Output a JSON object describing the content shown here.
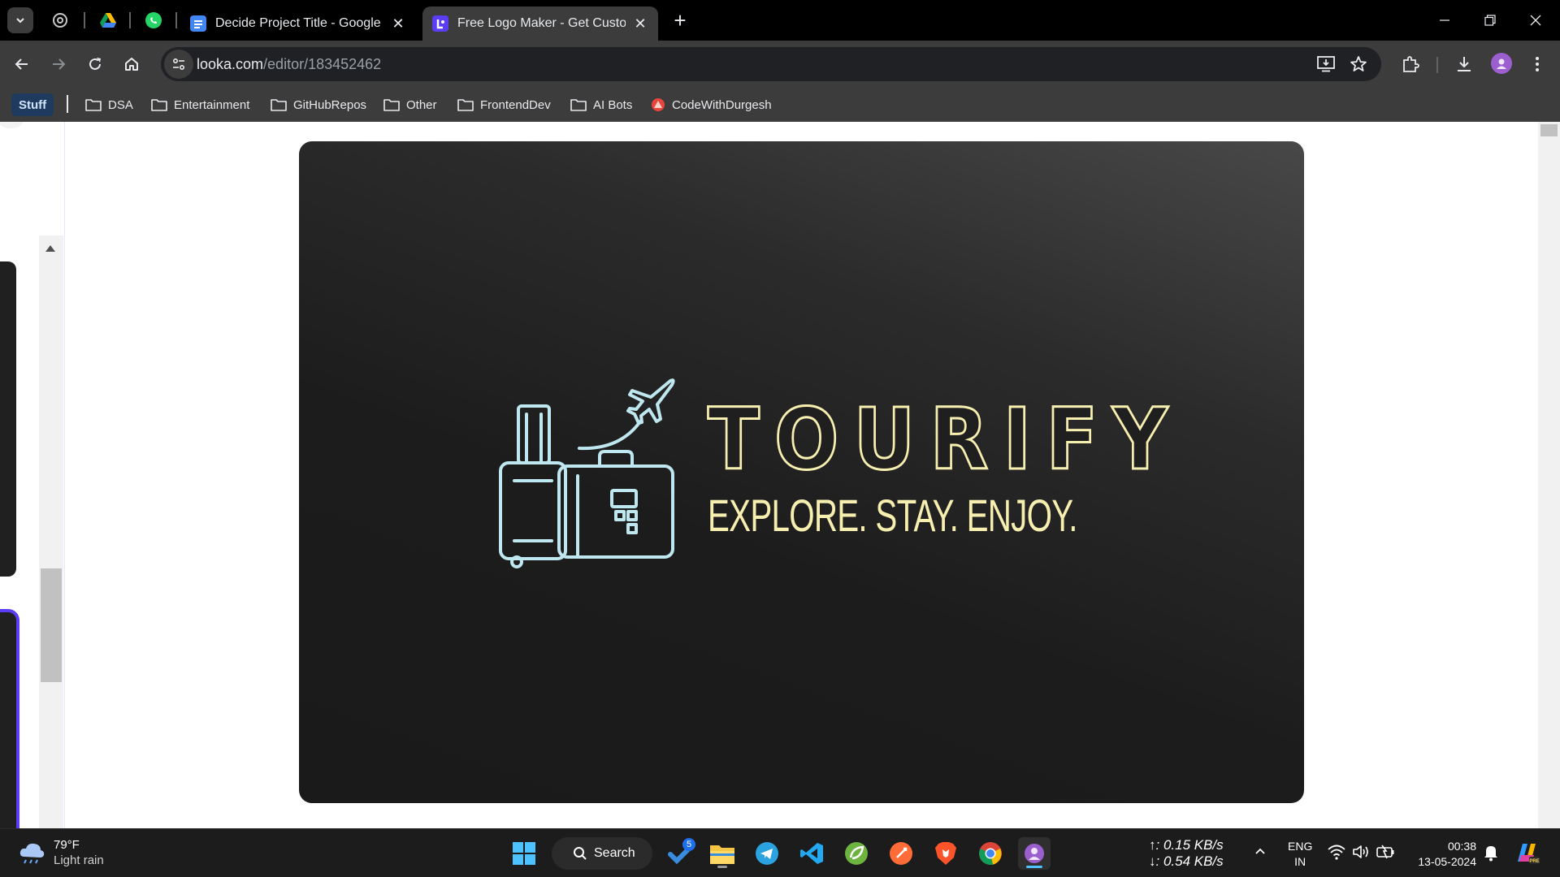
{
  "browser": {
    "tabs": [
      {
        "title": "Decide Project Title - Google Docs",
        "favicon": "google-docs-icon",
        "active": false
      },
      {
        "title": "Free Logo Maker - Get Custom Logo Designs",
        "favicon": "looka-icon",
        "active": true
      }
    ],
    "pinned_tabs": [
      "chatgpt-icon",
      "google-drive-icon",
      "whatsapp-icon"
    ],
    "url": {
      "domain": "looka.com",
      "path": "/editor/183452462"
    },
    "bookmarks": [
      {
        "label": "Stuff",
        "type": "app"
      },
      {
        "label": "DSA",
        "type": "folder"
      },
      {
        "label": "Entertainment",
        "type": "folder"
      },
      {
        "label": "GitHubRepos",
        "type": "folder"
      },
      {
        "label": "Other",
        "type": "folder"
      },
      {
        "label": "FrontendDev",
        "type": "folder"
      },
      {
        "label": "AI Bots",
        "type": "folder"
      },
      {
        "label": "CodeWithDurgesh",
        "type": "site"
      }
    ]
  },
  "logo": {
    "name": "TOURIFY",
    "tagline": "EXPLORE. STAY. ENJOY.",
    "name_color": "#f7efb0",
    "icon_color": "#bfe7ef",
    "icon": "luggage-airplane-icon"
  },
  "taskbar": {
    "weather": {
      "temp": "79°F",
      "desc": "Light rain"
    },
    "search_label": "Search",
    "apps": [
      "windows-start-icon",
      "search",
      "todo-icon",
      "file-explorer-icon",
      "telegram-icon",
      "vscode-icon",
      "spring-icon",
      "postman-icon",
      "brave-icon",
      "chrome-icon",
      "chrome-profile-icon"
    ],
    "todo_badge": "5",
    "net_up": "↑: 0.15 KB/s",
    "net_down": "↓: 0.54 KB/s",
    "lang_1": "ENG",
    "lang_2": "IN",
    "time": "00:38",
    "date": "13-05-2024"
  }
}
